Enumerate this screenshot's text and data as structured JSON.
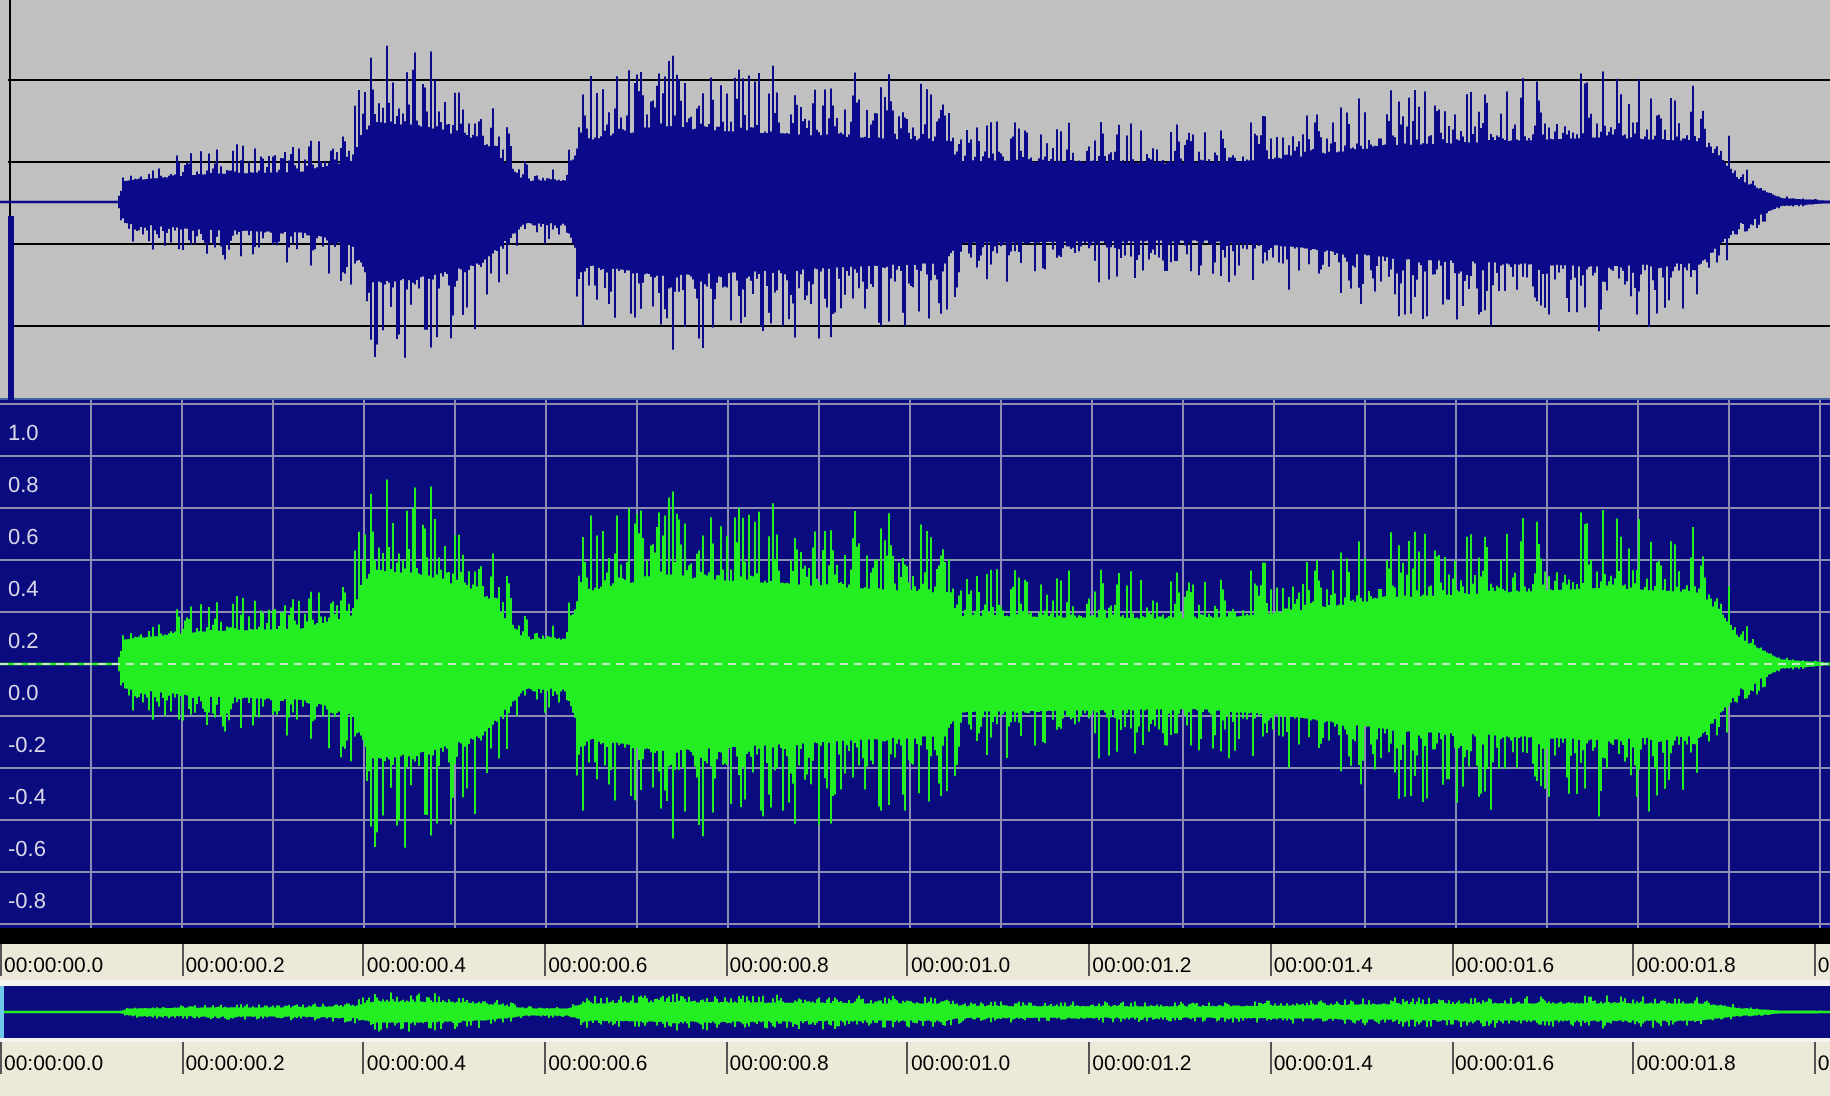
{
  "main_view": {
    "amplitude_labels": [
      "1.0",
      "0.8",
      "0.6",
      "0.4",
      "0.2",
      "0.0",
      "-0.2",
      "-0.4",
      "-0.6",
      "-0.8"
    ]
  },
  "time_ruler": {
    "labels": [
      "00:00:00.0",
      "00:00:00.2",
      "00:00:00.4",
      "00:00:00.6",
      "00:00:00.8",
      "00:00:01.0",
      "00:00:01.2",
      "00:00:01.4",
      "00:00:01.6",
      "00:00:01.8",
      "0"
    ]
  },
  "overview_ruler": {
    "labels": [
      "00:00:00.0",
      "00:00:00.2",
      "00:00:00.4",
      "00:00:00.6",
      "00:00:00.8",
      "00:00:01.0",
      "00:00:01.2",
      "00:00:01.4",
      "00:00:01.6",
      "00:00:01.8",
      "0"
    ]
  }
}
